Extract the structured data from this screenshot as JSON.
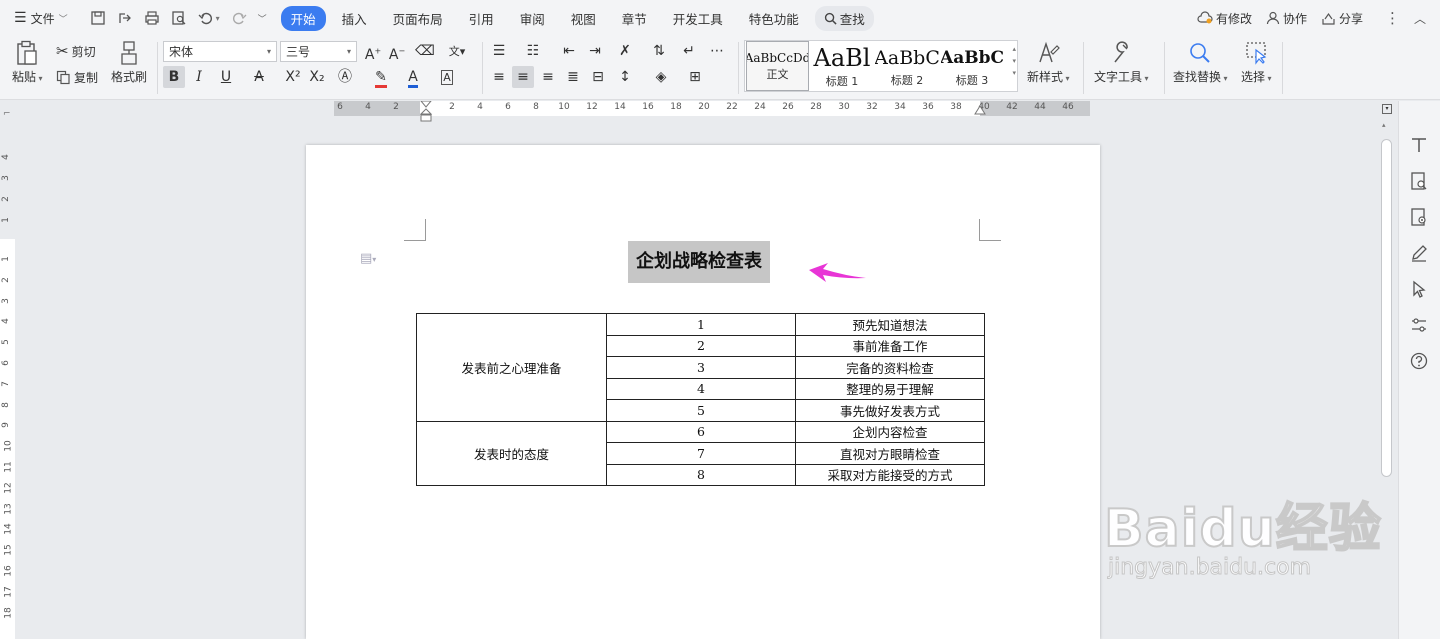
{
  "menubar": {
    "file_label": "文件",
    "tabs": [
      {
        "label": "开始",
        "active": true
      },
      {
        "label": "插入"
      },
      {
        "label": "页面布局"
      },
      {
        "label": "引用"
      },
      {
        "label": "审阅"
      },
      {
        "label": "视图"
      },
      {
        "label": "章节"
      },
      {
        "label": "开发工具"
      },
      {
        "label": "特色功能"
      }
    ],
    "search_label": "查找",
    "right": {
      "changes_label": "有修改",
      "collab_label": "协作",
      "share_label": "分享"
    }
  },
  "ribbon": {
    "paste_label": "粘贴",
    "cut_label": "剪切",
    "copy_label": "复制",
    "format_painter_label": "格式刷",
    "font_name": "宋体",
    "font_size": "三号",
    "bold_glyph": "B",
    "italic_glyph": "I",
    "underline_glyph": "U",
    "styles": [
      {
        "sample": "AaBbCcDd",
        "name": "正文",
        "selected": true
      },
      {
        "sample": "AaBl",
        "name": "标题 1"
      },
      {
        "sample": "AaBbC",
        "name": "标题 2"
      },
      {
        "sample": "AaBbC",
        "name": "标题 3"
      }
    ],
    "new_style_label": "新样式",
    "text_tools_label": "文字工具",
    "find_replace_label": "查找替换",
    "select_label": "选择"
  },
  "ruler": {
    "h_labels": [
      "6",
      "4",
      "2",
      "2",
      "4",
      "6",
      "8",
      "10",
      "12",
      "14",
      "16",
      "18",
      "20",
      "22",
      "24",
      "26",
      "28",
      "30",
      "32",
      "34",
      "36",
      "38",
      "40",
      "42",
      "44",
      "46"
    ],
    "v_labels_top": [
      "4",
      "3",
      "2",
      "1"
    ],
    "v_labels": [
      "1",
      "2",
      "3",
      "4",
      "5",
      "6",
      "7",
      "8",
      "9",
      "10",
      "11",
      "12",
      "13",
      "14",
      "15",
      "16",
      "17",
      "18"
    ]
  },
  "document": {
    "title": "企划战略检查表",
    "table": {
      "groups": [
        {
          "label": "发表前之心理准备",
          "rows": [
            {
              "num": "1",
              "item": "预先知道想法"
            },
            {
              "num": "2",
              "item": "事前准备工作"
            },
            {
              "num": "3",
              "item": "完备的资料检查"
            },
            {
              "num": "4",
              "item": "整理的易于理解"
            },
            {
              "num": "5",
              "item": "事先做好发表方式"
            }
          ]
        },
        {
          "label": "发表时的态度",
          "rows": [
            {
              "num": "6",
              "item": "企划内容检查"
            },
            {
              "num": "7",
              "item": "直视对方眼睛检查"
            },
            {
              "num": "8",
              "item": "采取对方能接受的方式"
            }
          ]
        }
      ]
    }
  },
  "watermark": {
    "logo": "Baidu经验",
    "url": "jingyan.baidu.com"
  },
  "colors": {
    "accent": "#3b7cf0",
    "annotation_arrow": "#e835d6",
    "title_highlight": "#c6c6c6"
  }
}
